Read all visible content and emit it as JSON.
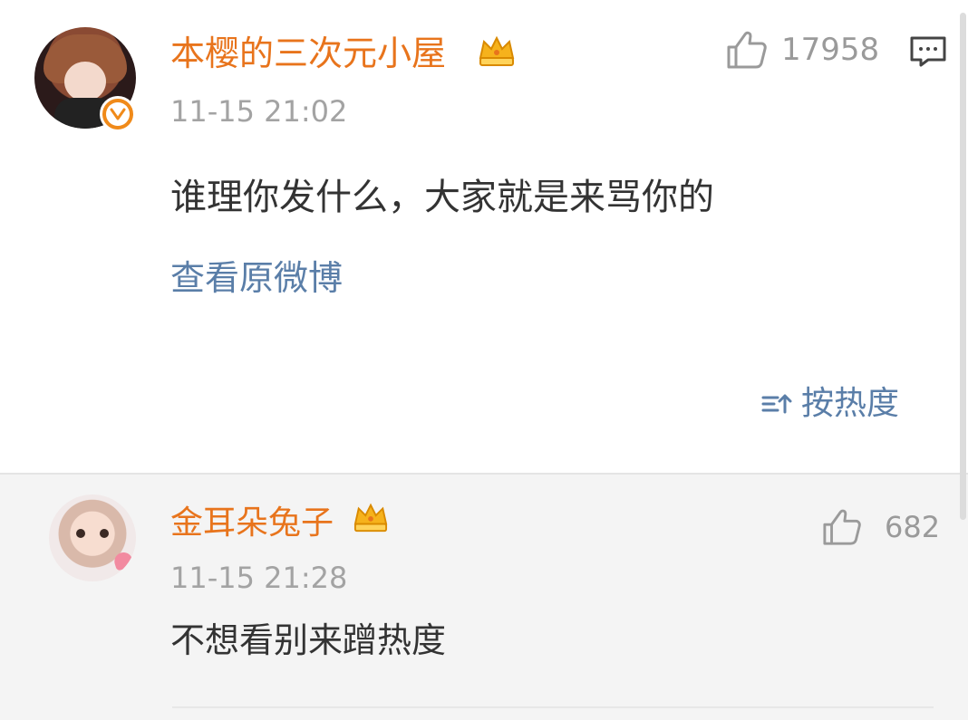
{
  "post": {
    "username": "本樱的三次元小屋",
    "time": "11-15 21:02",
    "like_count": "17958",
    "text": "谁理你发什么，大家就是来骂你的",
    "view_original": "查看原微博",
    "sort_label": "按热度",
    "icons": {
      "avatar": "user-avatar",
      "verified": "verified-badge-icon",
      "crown": "crown-icon",
      "like": "thumbs-up-icon",
      "comment": "comment-icon",
      "sort": "sort-icon"
    }
  },
  "reply": {
    "username": "金耳朵兔子",
    "time": "11-15 21:28",
    "like_count": "682",
    "text": "不想看别来蹭热度"
  },
  "colors": {
    "username": "#e8741c",
    "link": "#5a7ea8",
    "time": "#a3a3a3",
    "reply_bg": "#f4f4f4"
  }
}
